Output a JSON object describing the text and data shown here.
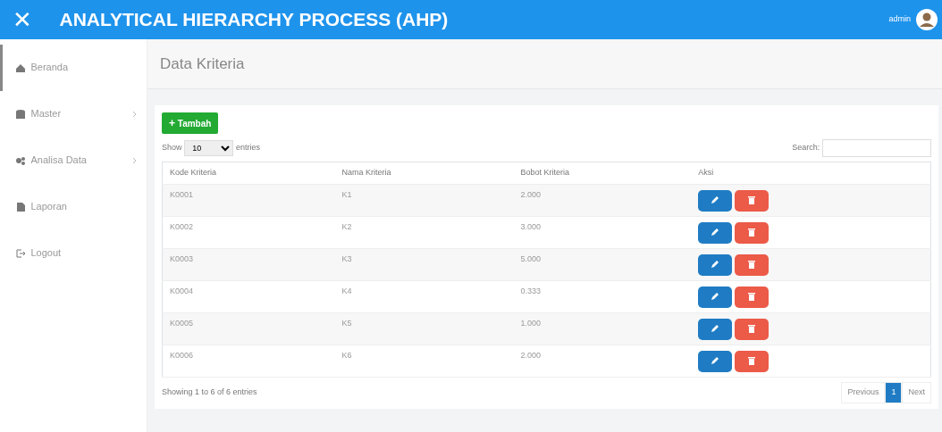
{
  "header": {
    "close_glyph": "✕",
    "title": "ANALYTICAL HIERARCHY PROCESS (AHP)",
    "user": "admin"
  },
  "sidebar": {
    "items": [
      {
        "label": "Beranda",
        "selected": true,
        "expandable": false
      },
      {
        "label": "Master",
        "selected": false,
        "expandable": true
      },
      {
        "label": "Analisa Data",
        "selected": false,
        "expandable": true
      },
      {
        "label": "Laporan",
        "selected": false,
        "expandable": false
      },
      {
        "label": "Logout",
        "selected": false,
        "expandable": false
      }
    ]
  },
  "page": {
    "title": "Data Kriteria"
  },
  "toolbar": {
    "add_glyph": "+",
    "add_button": "Tambah",
    "show_label": "Show",
    "page_size": "10",
    "entries_label": "entries",
    "search_label": "Search:"
  },
  "table": {
    "columns": [
      "Kode Kriteria",
      "Nama Kriteria",
      "Bobot Kriteria",
      "Aksi"
    ],
    "rows": [
      [
        "K0001",
        "K1",
        "2.000"
      ],
      [
        "K0002",
        "K2",
        "3.000"
      ],
      [
        "K0003",
        "K3",
        "5.000"
      ],
      [
        "K0004",
        "K4",
        "0.333"
      ],
      [
        "K0005",
        "K5",
        "1.000"
      ],
      [
        "K0006",
        "K6",
        "2.000"
      ]
    ]
  },
  "footer": {
    "info": "Showing 1 to 6 of 6 entries",
    "pagination": [
      {
        "label": "Previous",
        "selected": false
      },
      {
        "label": "1",
        "selected": true
      },
      {
        "label": "Next",
        "selected": false
      }
    ]
  }
}
